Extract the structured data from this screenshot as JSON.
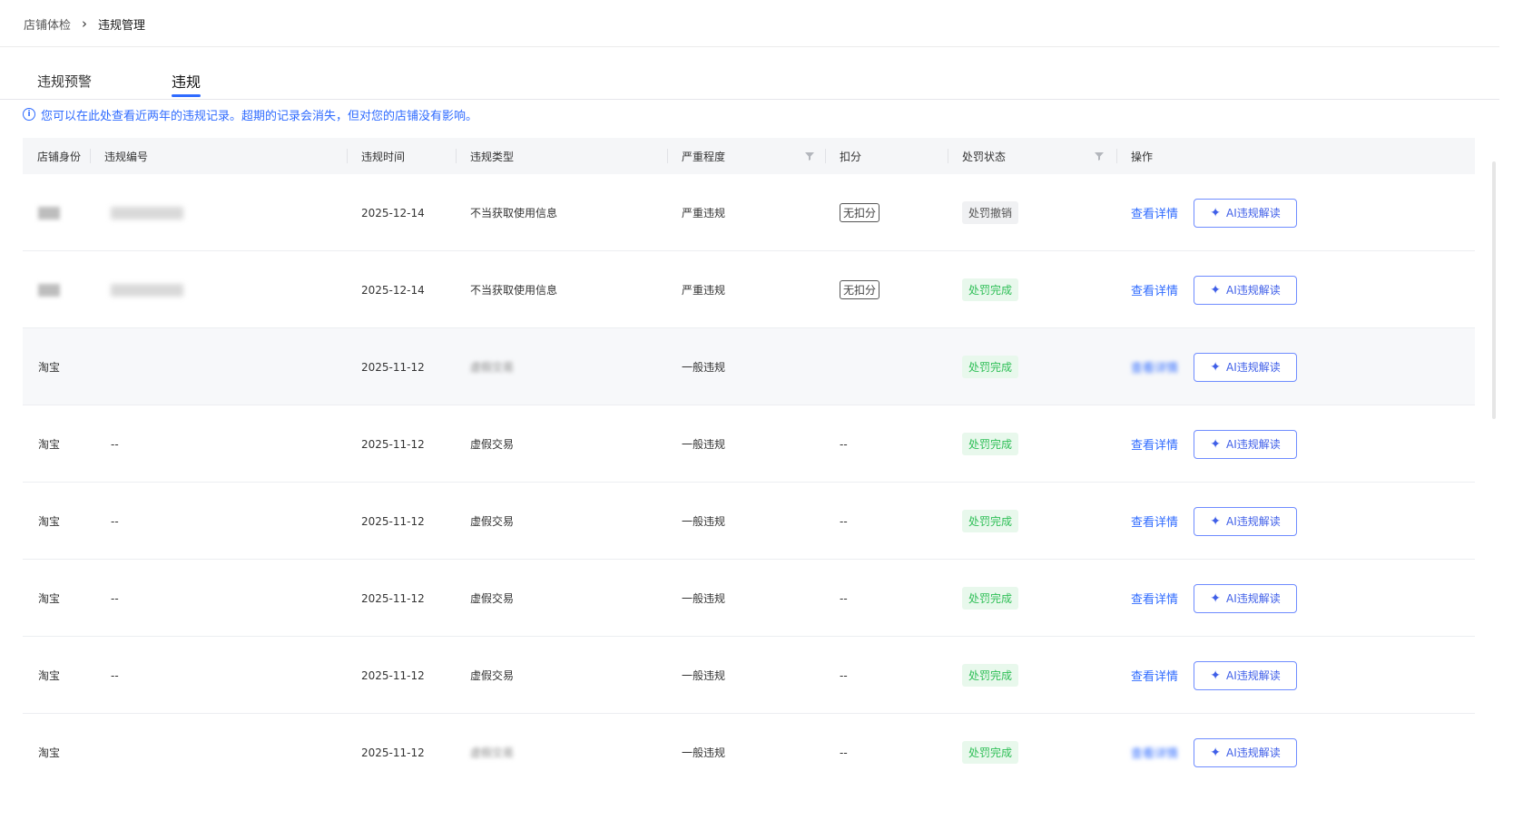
{
  "breadcrumb": {
    "parent": "店铺体检",
    "separator": "›",
    "current": "违规管理"
  },
  "tabs": [
    {
      "label": "违规预警",
      "active": false
    },
    {
      "label": "违规",
      "active": true
    }
  ],
  "notice": {
    "icon": "info-icon",
    "text": "您可以在此处查看近两年的违规记录。超期的记录会消失，但对您的店铺没有影响。"
  },
  "table": {
    "columns": [
      "店铺身份",
      "违规编号",
      "违规时间",
      "违规类型",
      "严重程度",
      "扣分",
      "处罚状态",
      "操作"
    ],
    "filterable": [
      "严重程度",
      "处罚状态"
    ],
    "rows": [
      {
        "shop": "",
        "id": "",
        "time": "2025-12-14",
        "type": "不当获取使用信息",
        "severity": "严重违规",
        "deduction": "无扣分",
        "status": "处罚撤销",
        "status_kind": "revoked",
        "detail": "查看详情",
        "ai": "AI违规解读"
      },
      {
        "shop": "",
        "id": "",
        "time": "2025-12-14",
        "type": "不当获取使用信息",
        "severity": "严重违规",
        "deduction": "无扣分",
        "status": "处罚完成",
        "status_kind": "done",
        "detail": "查看详情",
        "ai": "AI违规解读"
      },
      {
        "shop": "淘宝",
        "id": "",
        "time": "2025-11-12",
        "type": "虚假交易",
        "severity": "一般违规",
        "deduction": "",
        "status": "处罚完成",
        "status_kind": "done",
        "detail": "查看详情",
        "ai": "AI违规解读"
      },
      {
        "shop": "淘宝",
        "id": "--",
        "time": "2025-11-12",
        "type": "虚假交易",
        "severity": "一般违规",
        "deduction": "--",
        "status": "处罚完成",
        "status_kind": "done",
        "detail": "查看详情",
        "ai": "AI违规解读"
      },
      {
        "shop": "淘宝",
        "id": "--",
        "time": "2025-11-12",
        "type": "虚假交易",
        "severity": "一般违规",
        "deduction": "--",
        "status": "处罚完成",
        "status_kind": "done",
        "detail": "查看详情",
        "ai": "AI违规解读"
      },
      {
        "shop": "淘宝",
        "id": "--",
        "time": "2025-11-12",
        "type": "虚假交易",
        "severity": "一般违规",
        "deduction": "--",
        "status": "处罚完成",
        "status_kind": "done",
        "detail": "查看详情",
        "ai": "AI违规解读"
      },
      {
        "shop": "淘宝",
        "id": "--",
        "time": "2025-11-12",
        "type": "虚假交易",
        "severity": "一般违规",
        "deduction": "--",
        "status": "处罚完成",
        "status_kind": "done",
        "detail": "查看详情",
        "ai": "AI违规解读"
      },
      {
        "shop": "淘宝",
        "id": "",
        "time": "2025-11-12",
        "type": "虚假交易",
        "severity": "一般违规",
        "deduction": "--",
        "status": "处罚完成",
        "status_kind": "done",
        "detail": "查看详情",
        "ai": "AI违规解读"
      }
    ]
  },
  "colors": {
    "accent": "#2f6bff",
    "success_bg": "#e8f8ec",
    "success_text": "#2fbf57",
    "ai_border": "#6f8cff"
  }
}
